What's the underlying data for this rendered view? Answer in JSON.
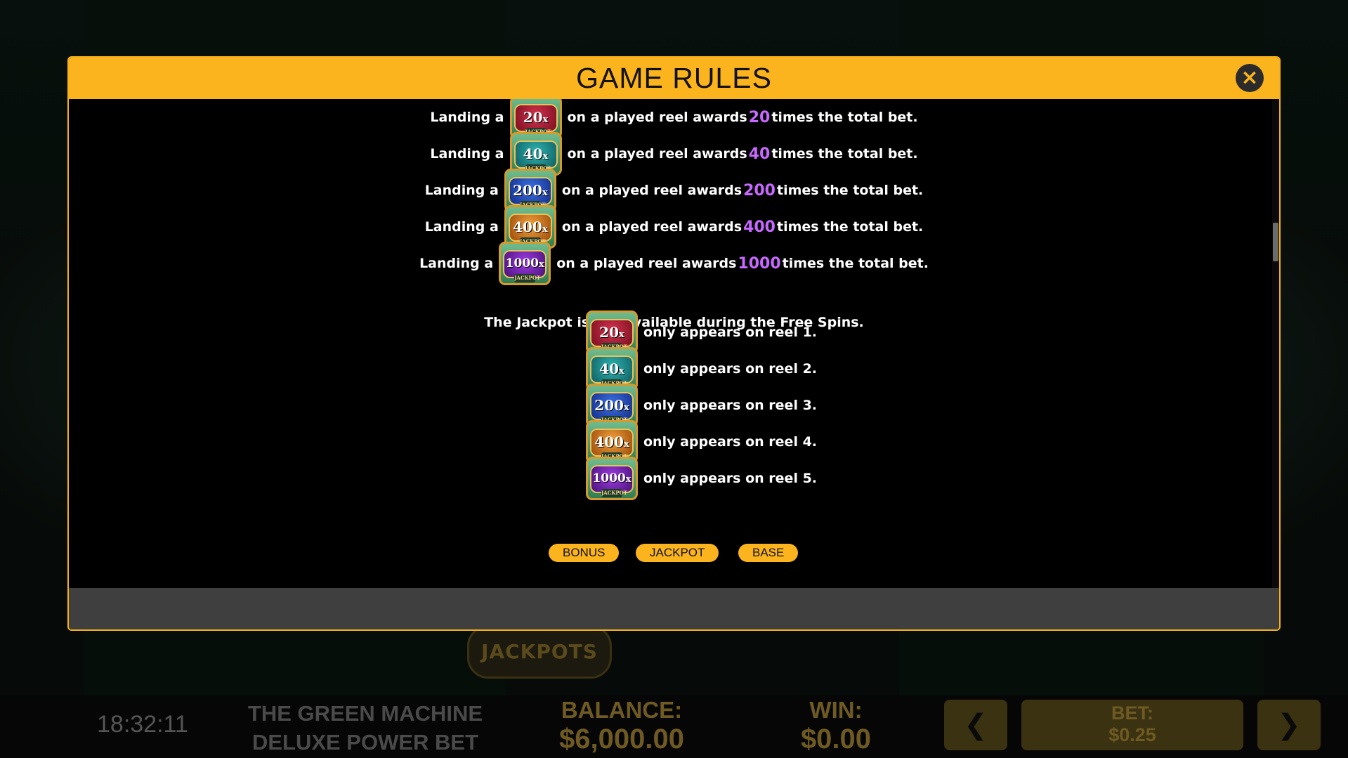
{
  "modal": {
    "title": "GAME RULES",
    "close_icon": "×"
  },
  "rules": {
    "award_rows": [
      {
        "prefix": "Landing a",
        "symbol": "20",
        "mid": "on a played reel awards",
        "multiplier": "20",
        "suffix": "times the total bet.",
        "color": "red"
      },
      {
        "prefix": "Landing a",
        "symbol": "40",
        "mid": "on a played reel awards",
        "multiplier": "40",
        "suffix": "times the total bet.",
        "color": "teal"
      },
      {
        "prefix": "Landing a",
        "symbol": "200",
        "mid": "on a played reel awards",
        "multiplier": "200",
        "suffix": "times the total bet.",
        "color": "blue"
      },
      {
        "prefix": "Landing a",
        "symbol": "400",
        "mid": "on a played reel awards",
        "multiplier": "400",
        "suffix": "times the total bet.",
        "color": "orange"
      },
      {
        "prefix": "Landing a",
        "symbol": "1000",
        "mid": "on a played reel awards",
        "multiplier": "1000",
        "suffix": "times the total bet.",
        "color": "purple"
      }
    ],
    "free_spins_note": "The Jackpot is not available during the Free Spins.",
    "reel_rows": [
      {
        "symbol": "20",
        "text": "only appears on reel 1.",
        "color": "red"
      },
      {
        "symbol": "40",
        "text": "only appears on reel 2.",
        "color": "teal"
      },
      {
        "symbol": "200",
        "text": "only appears on reel 3.",
        "color": "blue"
      },
      {
        "symbol": "400",
        "text": "only appears on reel 4.",
        "color": "orange"
      },
      {
        "symbol": "1000",
        "text": "only appears on reel 5.",
        "color": "purple"
      }
    ],
    "symbol_suffix": "x",
    "symbol_tag": "JACKPOT"
  },
  "tabs": [
    {
      "label": "BONUS"
    },
    {
      "label": "JACKPOT"
    },
    {
      "label": "BASE"
    }
  ],
  "background": {
    "jackpots_sign": "JACKPOTS"
  },
  "bottom_bar": {
    "clock": "18:32:11",
    "game_name_line1": "THE GREEN MACHINE",
    "game_name_line2": "DELUXE POWER BET",
    "balance_label": "BALANCE:",
    "balance_value": "$6,000.00",
    "win_label": "WIN:",
    "win_value": "$0.00",
    "prev_icon": "❮",
    "next_icon": "❯",
    "bet_label": "BET:",
    "bet_value": "$0.25"
  },
  "colors": {
    "accent": "#fbb41d",
    "multiplier": "#c768ff",
    "footer": "#3f3f3f"
  }
}
